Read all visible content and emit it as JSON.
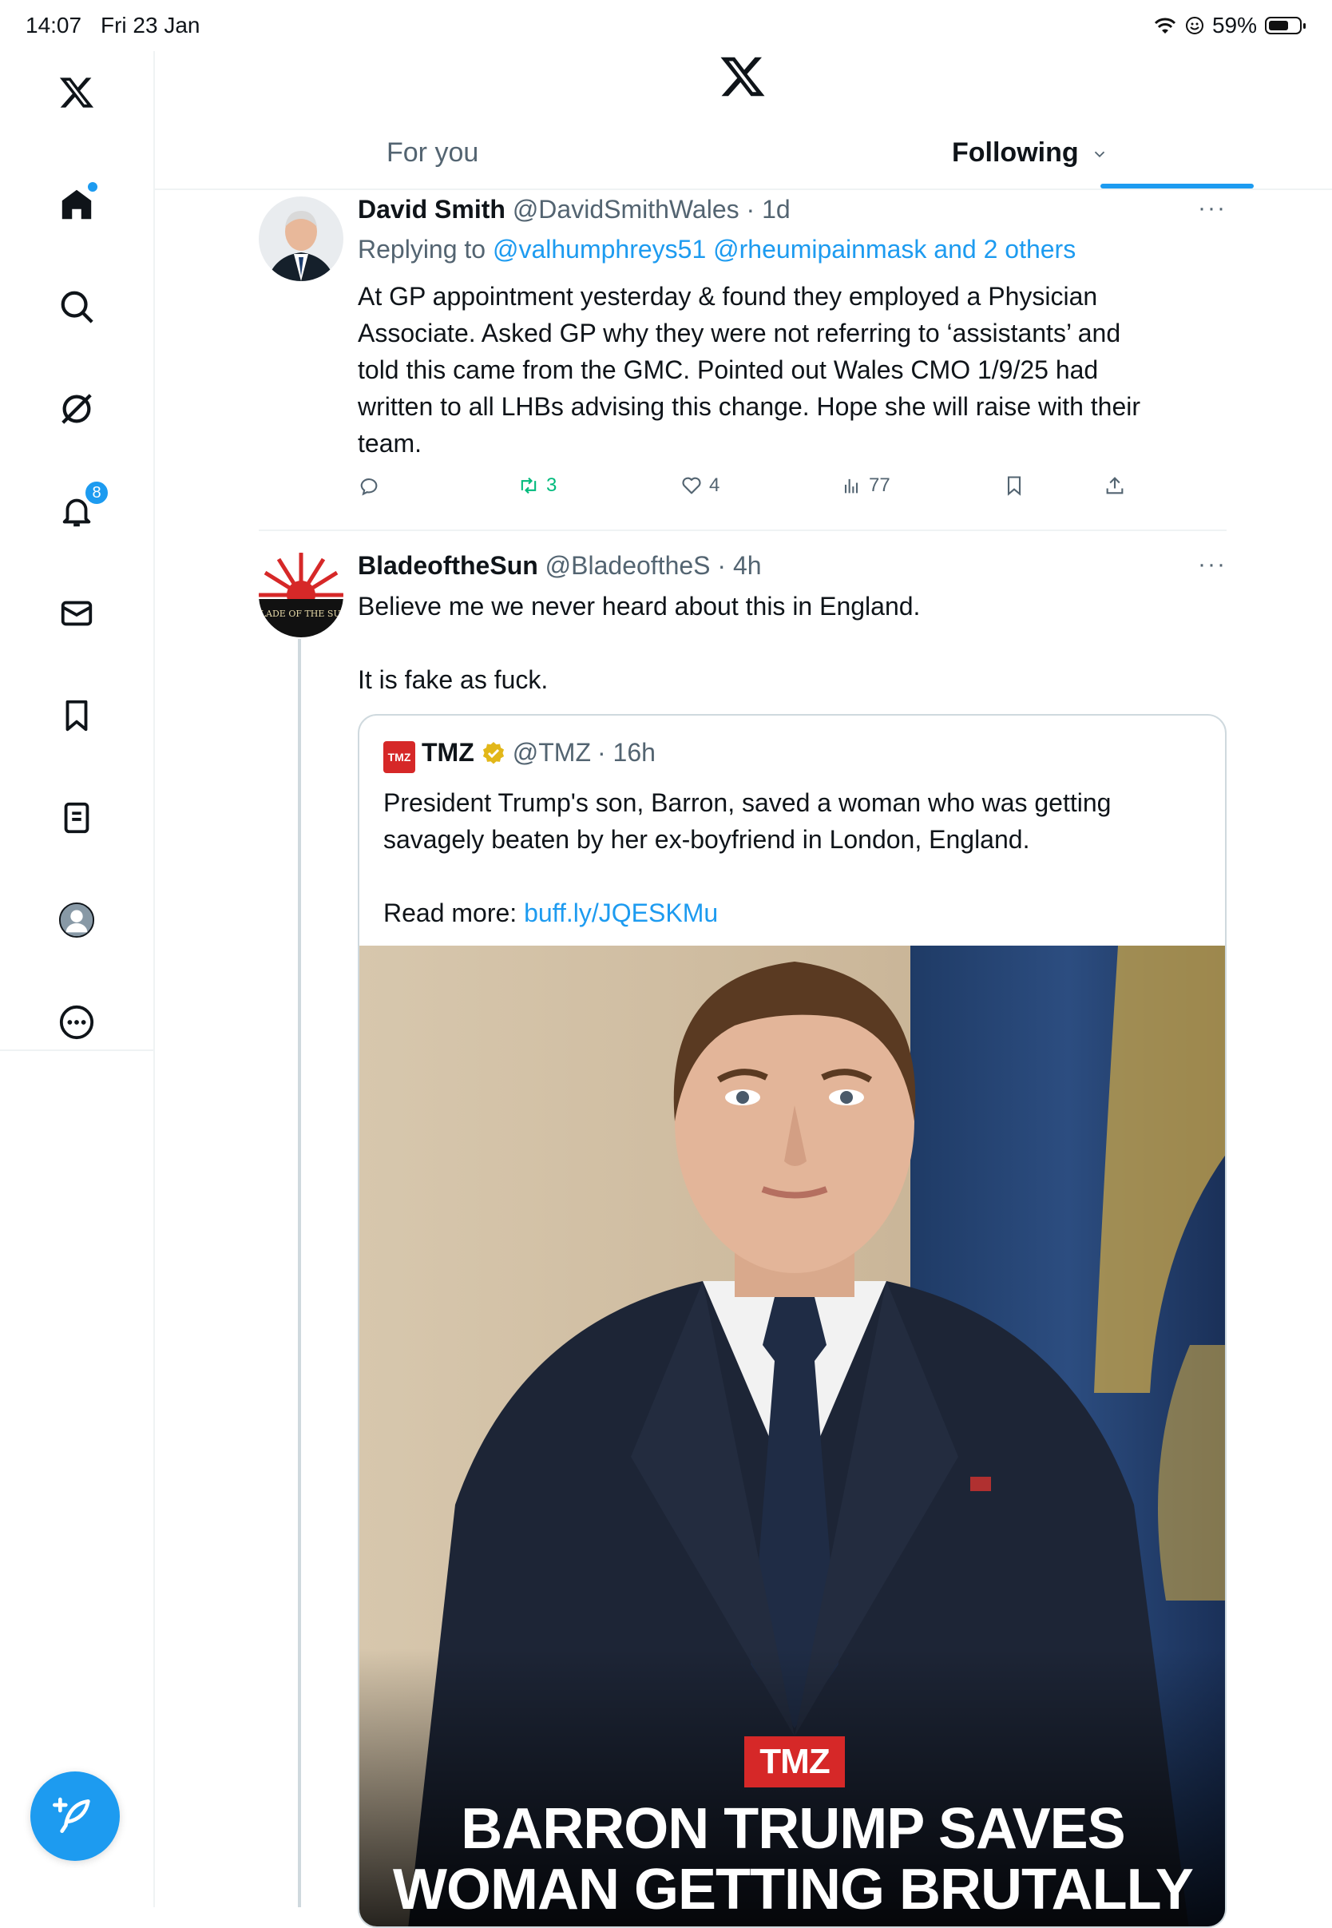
{
  "status_bar": {
    "time": "14:07",
    "date": "Fri 23 Jan",
    "battery": "59%",
    "battery_level": 0.59
  },
  "sidebar": {
    "items": [
      {
        "name": "x-logo-icon"
      },
      {
        "name": "home-icon"
      },
      {
        "name": "search-icon"
      },
      {
        "name": "grok-icon"
      },
      {
        "name": "bell-icon",
        "badge": "8"
      },
      {
        "name": "mail-icon"
      },
      {
        "name": "bookmark-icon"
      },
      {
        "name": "lists-icon"
      },
      {
        "name": "profile-icon"
      },
      {
        "name": "more-icon"
      }
    ],
    "compose_icon": "feather-plus-icon"
  },
  "tabs": {
    "for_you": "For you",
    "following": "Following"
  },
  "tweets": [
    {
      "name": "David Smith",
      "handle": "@DavidSmithWales",
      "time": "· 1d",
      "replying_prefix": "Replying to",
      "replying_to": "@valhumphreys51 @rheumipainmask and 2 others",
      "text_lines": [
        "At GP appointment yesterday & found they employed a Physician",
        "Associate. Asked GP why they were not referring to ‘assistants’ and",
        "told this came from the GMC. Pointed out Wales CMO 1/9/25 had",
        "written to all LHBs advising this change. Hope she will raise with their",
        "team."
      ],
      "retweets": "3",
      "likes": "4",
      "views": "77",
      "more": "···"
    },
    {
      "name": "BladeoftheSun",
      "handle": "@BladeoftheS",
      "time": "· 4h",
      "text_line1": "Believe me we never heard about this in England.",
      "text_line2": "It is fake as fuck.",
      "avatar_text": "BLADE OF THE SUN",
      "more": "···",
      "quote": {
        "logo": "TMZ",
        "name": "TMZ",
        "handle": "@TMZ",
        "time": "· 16h",
        "text_line1": "President Trump's son, Barron, saved a woman who was getting",
        "text_line2": "savagely beaten by her ex-boyfriend in London, England.",
        "read_more_prefix": "Read more:",
        "link": "buff.ly/JQESKMu",
        "image": {
          "tmz_badge": "TMZ",
          "headline_line1": "BARRON TRUMP SAVES",
          "headline_line2": "WOMAN GETTING BRUTALLY"
        }
      }
    }
  ],
  "colors": {
    "accent": "#1d9bf0",
    "muted": "#536471",
    "retweet_green": "#00ba7c",
    "tmz_red": "#d62828"
  }
}
